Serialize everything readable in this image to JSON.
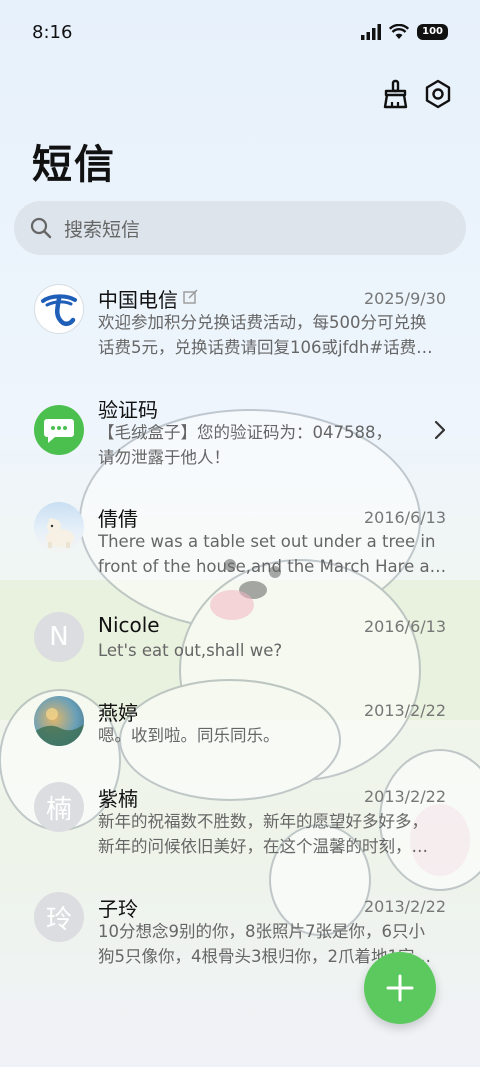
{
  "status_bar": {
    "time": "8:16",
    "battery": "100"
  },
  "header": {
    "title": "短信"
  },
  "search": {
    "placeholder": "搜索短信"
  },
  "messages": [
    {
      "sender": "中国电信",
      "date": "2025/9/30",
      "line1": "欢迎参加积分兑换话费活动，每500分可兑换",
      "line2": "话费5元，兑换话费请回复106或jfdh#话费…"
    },
    {
      "sender": "验证码",
      "date": "",
      "line1": "【毛绒盒子】您的验证码为：047588，",
      "line2": "请勿泄露于他人！"
    },
    {
      "sender": "倩倩",
      "date": "2016/6/13",
      "line1": "There was a table set out under a tree in",
      "line2": "front of the house,and the March Hare an…"
    },
    {
      "sender": "Nicole",
      "date": "2016/6/13",
      "line1": "Let's eat out,shall we?",
      "line2": "",
      "avatar_letter": "N"
    },
    {
      "sender": "燕婷",
      "date": "2013/2/22",
      "line1": "嗯。收到啦。同乐同乐。",
      "line2": ""
    },
    {
      "sender": "紫楠",
      "date": "2013/2/22",
      "line1": "新年的祝福数不胜数，新年的愿望好多好多，",
      "line2": "新年的问候依旧美好，在这个温馨的时刻，…",
      "avatar_letter": "楠"
    },
    {
      "sender": "子玲",
      "date": "2013/2/22",
      "line1": "10分想念9别的你，8张照片7张是你，6只小",
      "line2": "狗5只像你，4根骨头3根归你，2爪着地1定…",
      "avatar_letter": "玲"
    }
  ],
  "colors": {
    "accent": "#5bc95e",
    "telecom_blue": "#1f5fb8",
    "verify_green": "#4cc04f"
  }
}
